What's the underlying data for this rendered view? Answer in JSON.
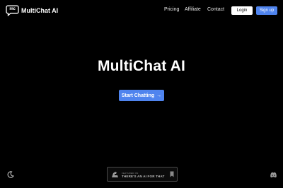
{
  "header": {
    "logo_mark": "mc",
    "brand": "MultiChat AI",
    "nav": {
      "pricing": "Pricing",
      "affiliate": "Affiliate",
      "contact": "Contact"
    },
    "login": "Login",
    "signup": "Sign up"
  },
  "hero": {
    "title": "MultiChat AI",
    "cta": "Start Chatting",
    "cta_arrow": "→"
  },
  "badge": {
    "small": "FEATURED ON",
    "main": "THERE'S AN AI FOR THAT"
  },
  "icons": {
    "theme_toggle": "moon-icon",
    "community": "discord-icon",
    "badge_logo": "arm-icon",
    "badge_save": "bookmark-icon"
  },
  "colors": {
    "background": "#000000",
    "accent": "#4f84ee",
    "login_bg": "#ffffff"
  }
}
